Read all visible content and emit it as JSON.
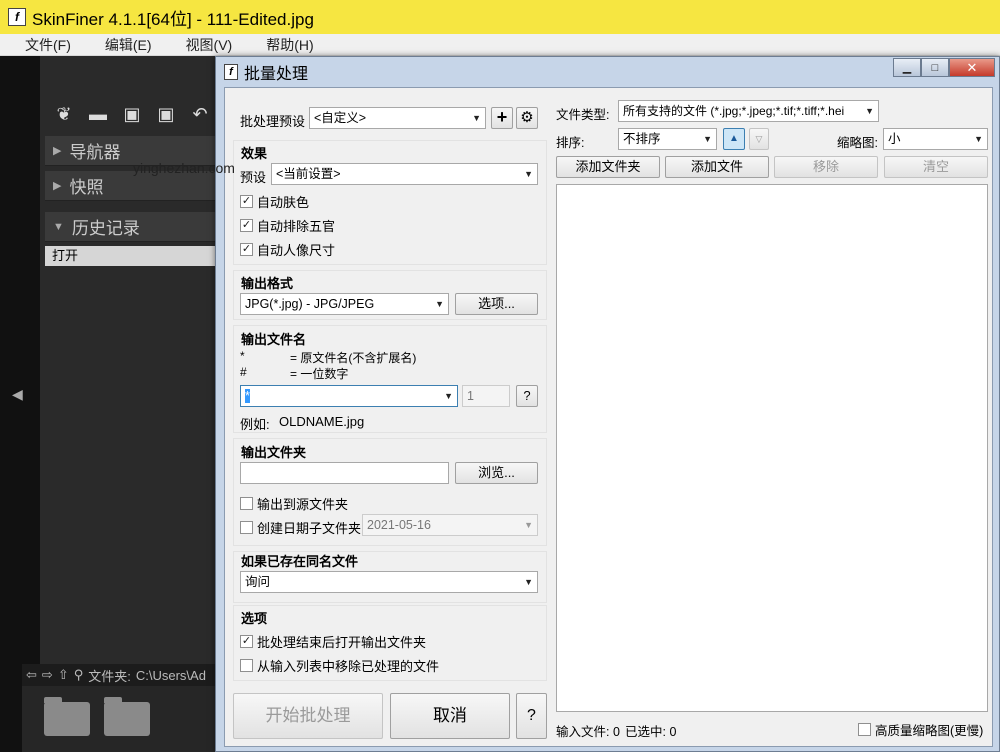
{
  "app": {
    "title": "SkinFiner 4.1.1[64位] - 111-Edited.jpg",
    "logo": "f",
    "menu": [
      "文件(F)",
      "编辑(E)",
      "视图(V)",
      "帮助(H)"
    ],
    "panels": [
      "导航器",
      "快照",
      "历史记录"
    ],
    "history_item": "打开",
    "path_label": "文件夹:",
    "path_value": "C:\\Users\\Ad",
    "watermark": "yinghezhan.com"
  },
  "dialog": {
    "title": "批量处理",
    "preset_label": "批处理预设",
    "preset_value": "<自定义>",
    "effects": {
      "title": "效果",
      "preset_label": "预设",
      "preset_value": "<当前设置>",
      "checks": [
        {
          "label": "自动肤色",
          "checked": true
        },
        {
          "label": "自动排除五官",
          "checked": true
        },
        {
          "label": "自动人像尺寸",
          "checked": true
        }
      ]
    },
    "output_format": {
      "title": "输出格式",
      "value": "JPG(*.jpg) - JPG/JPEG",
      "options_button": "选项..."
    },
    "output_filename": {
      "title": "输出文件名",
      "legend1_sym": "*",
      "legend1_text": "= 原文件名(不含扩展名)",
      "legend2_sym": "#",
      "legend2_text": "= 一位数字",
      "pattern_value": "*",
      "number_value": "1",
      "help_button": "?",
      "example_label": "例如:",
      "example_value": "OLDNAME.jpg"
    },
    "output_folder": {
      "title": "输出文件夹",
      "browse_button": "浏览...",
      "to_source_label": "输出到源文件夹",
      "date_subfolder_label": "创建日期子文件夹",
      "date_value": "2021-05-16"
    },
    "if_exists": {
      "title": "如果已存在同名文件",
      "value": "询问"
    },
    "options": {
      "title": "选项",
      "open_after_label": "批处理结束后打开输出文件夹",
      "open_after_checked": true,
      "remove_processed_label": "从输入列表中移除已处理的文件",
      "remove_processed_checked": false
    },
    "start_button": "开始批处理",
    "cancel_button": "取消",
    "help_button": "?",
    "file_type_label": "文件类型:",
    "file_type_value": "所有支持的文件 (*.jpg;*.jpeg;*.tif;*.tiff;*.hei",
    "sort_label": "排序:",
    "sort_value": "不排序",
    "thumb_label": "缩略图:",
    "thumb_value": "小",
    "add_folder_button": "添加文件夹",
    "add_file_button": "添加文件",
    "remove_button": "移除",
    "clear_button": "清空",
    "status_input": "输入文件: 0",
    "status_selected": "已选中: 0",
    "hq_thumb_label": "高质量缩略图(更慢)"
  }
}
